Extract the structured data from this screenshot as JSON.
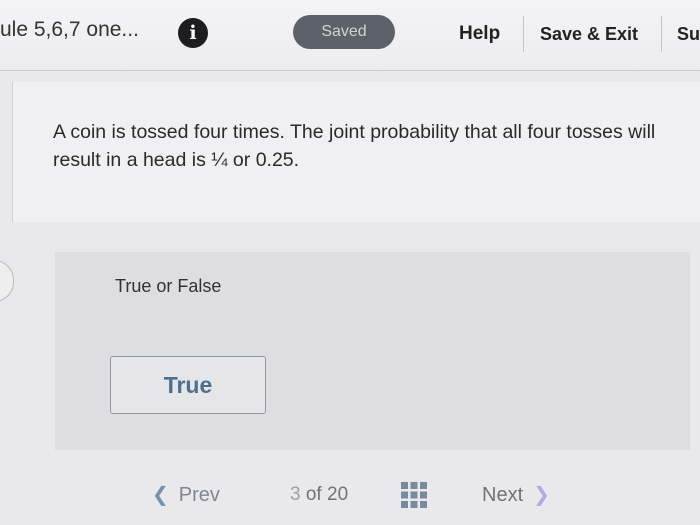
{
  "header": {
    "module_title": "ule 5,6,7 one...",
    "info_icon": "info-icon",
    "saved_status": "Saved",
    "help_label": "Help",
    "save_exit_label": "Save & Exit",
    "submit_label": "Su"
  },
  "question": {
    "text": "A coin is tossed four times. The joint probability that all four tosses will result in a head is ¼ or 0.25."
  },
  "answer": {
    "type_label": "True or False",
    "options": [
      {
        "label": "True"
      }
    ]
  },
  "pagination": {
    "prev_label": "Prev",
    "prev_icon": "chevron-left-icon",
    "current": "3",
    "of_label": "of",
    "total": "20",
    "grid_icon": "grid-icon",
    "next_label": "Next",
    "next_icon": "chevron-right-icon"
  },
  "colors": {
    "accent": "#4d6f90",
    "saved_pill": "#5d6168"
  }
}
